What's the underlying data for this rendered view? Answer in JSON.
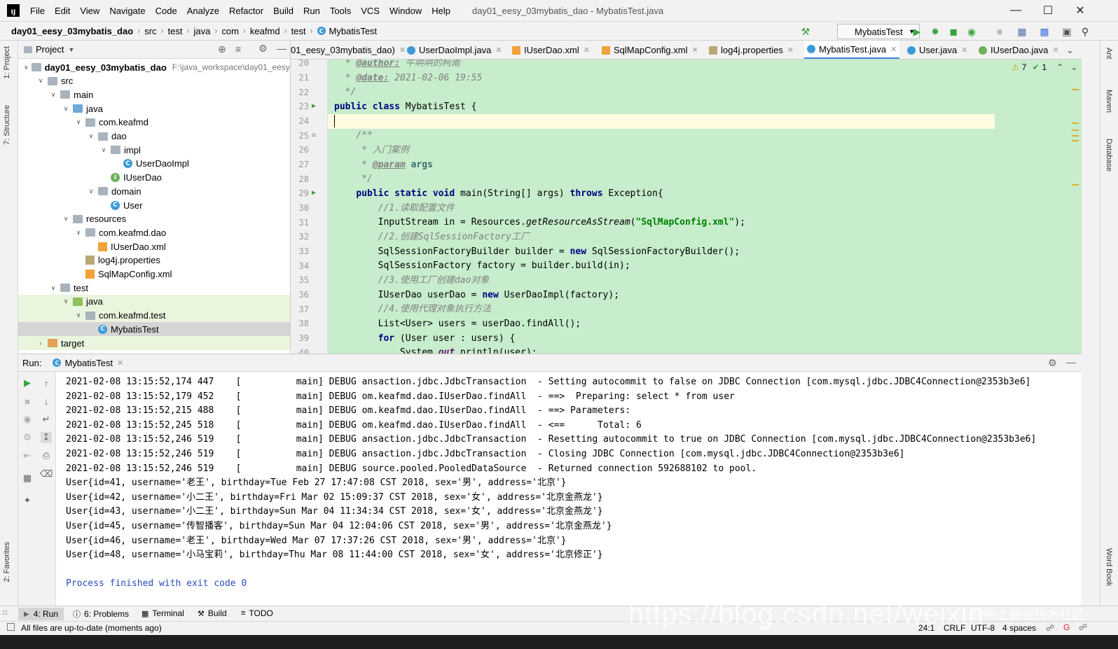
{
  "menu": {
    "items": [
      "File",
      "Edit",
      "View",
      "Navigate",
      "Code",
      "Analyze",
      "Refactor",
      "Build",
      "Run",
      "Tools",
      "VCS",
      "Window",
      "Help"
    ],
    "window_title": "day01_eesy_03mybatis_dao - MybatisTest.java"
  },
  "breadcrumb": [
    "day01_eesy_03mybatis_dao",
    "src",
    "test",
    "java",
    "com",
    "keafmd",
    "test",
    "MybatisTest"
  ],
  "run_config": "MybatisTest",
  "left_tools": {
    "project": "1: Project",
    "structure": "7: Structure",
    "favorites": "2: Favorites"
  },
  "right_tools": {
    "ant": "Ant",
    "maven": "Maven",
    "database": "Database",
    "wordbook": "Word Book"
  },
  "project_panel": {
    "title": "Project",
    "tree": [
      {
        "label": "day01_eesy_03mybatis_dao",
        "extra": "F:\\java_workspace\\day01_eesy_",
        "depth": 0,
        "icon": "folder",
        "open": true,
        "bold": true
      },
      {
        "label": "src",
        "depth": 1,
        "icon": "folder",
        "open": true
      },
      {
        "label": "main",
        "depth": 2,
        "icon": "folder",
        "open": true
      },
      {
        "label": "java",
        "depth": 3,
        "icon": "folder-blue",
        "open": true
      },
      {
        "label": "com.keafmd",
        "depth": 4,
        "icon": "package",
        "open": true
      },
      {
        "label": "dao",
        "depth": 5,
        "icon": "package",
        "open": true
      },
      {
        "label": "impl",
        "depth": 6,
        "icon": "package",
        "open": true
      },
      {
        "label": "UserDaoImpl",
        "depth": 7,
        "icon": "class"
      },
      {
        "label": "IUserDao",
        "depth": 6,
        "icon": "interface"
      },
      {
        "label": "domain",
        "depth": 5,
        "icon": "package",
        "open": true
      },
      {
        "label": "User",
        "depth": 6,
        "icon": "class"
      },
      {
        "label": "resources",
        "depth": 3,
        "icon": "folder",
        "open": true
      },
      {
        "label": "com.keafmd.dao",
        "depth": 4,
        "icon": "package",
        "open": true
      },
      {
        "label": "IUserDao.xml",
        "depth": 5,
        "icon": "xml"
      },
      {
        "label": "log4j.properties",
        "depth": 4,
        "icon": "properties"
      },
      {
        "label": "SqlMapConfig.xml",
        "depth": 4,
        "icon": "xml"
      },
      {
        "label": "test",
        "depth": 2,
        "icon": "folder",
        "open": true
      },
      {
        "label": "java",
        "depth": 3,
        "icon": "folder-green",
        "open": true,
        "highlight": true
      },
      {
        "label": "com.keafmd.test",
        "depth": 4,
        "icon": "package",
        "open": true,
        "highlight": true
      },
      {
        "label": "MybatisTest",
        "depth": 5,
        "icon": "class",
        "selected": true
      },
      {
        "label": "target",
        "depth": 1,
        "icon": "folder-orange",
        "open": false,
        "highlight": true
      }
    ]
  },
  "editor": {
    "tabs": [
      {
        "label": "01_eesy_03mybatis_dao)",
        "icon": "none"
      },
      {
        "label": "UserDaoImpl.java",
        "icon": "class"
      },
      {
        "label": "IUserDao.xml",
        "icon": "xml"
      },
      {
        "label": "SqlMapConfig.xml",
        "icon": "xml"
      },
      {
        "label": "log4j.properties",
        "icon": "properties"
      },
      {
        "label": "MybatisTest.java",
        "icon": "class",
        "active": true
      },
      {
        "label": "User.java",
        "icon": "class"
      },
      {
        "label": "IUserDao.java",
        "icon": "interface"
      }
    ],
    "inspections": {
      "warnings": "7",
      "ok": "1"
    },
    "line_numbers": [
      "20",
      "21",
      "22",
      "23",
      "24",
      "25",
      "26",
      "27",
      "28",
      "29",
      "30",
      "31",
      "32",
      "33",
      "34",
      "35",
      "36",
      "37",
      "38",
      "39",
      "40"
    ],
    "lines": {
      "l20_tag": "@author:",
      "l20_text": " 牛哄哄的柯南",
      "l21_tag": "@date:",
      "l21_text": " 2021-02-06 19:55",
      "l22": "*/",
      "l23_kw": "public class",
      "l23_rest": " MybatisTest {",
      "l25": "/**",
      "l26": "* 入门案例",
      "l27_tag": "@param",
      "l27_param": "args",
      "l28": "*/",
      "l29_kw1": "public static void",
      "l29_mid": " main(String[] args) ",
      "l29_kw2": "throws",
      "l29_end": " Exception{",
      "l30": "//1.读取配置文件",
      "l31_a": "InputStream in = Resources.",
      "l31_method": "getResourceAsStream",
      "l31_b": "(",
      "l31_str": "\"SqlMapConfig.xml\"",
      "l31_c": ");",
      "l32": "//2.创建SqlSessionFactory工厂",
      "l33_a": "SqlSessionFactoryBuilder builder = ",
      "l33_kw": "new",
      "l33_b": " SqlSessionFactoryBuilder();",
      "l34": "SqlSessionFactory factory = builder.build(in);",
      "l35": "//3.使用工厂创建dao对象",
      "l36_a": "IUserDao userDao = ",
      "l36_kw": "new",
      "l36_b": " UserDaoImpl(factory);",
      "l37": "//4.使用代理对象执行方法",
      "l38": "List<User> users = userDao.findAll();",
      "l39_kw": "for",
      "l39_b": " (User user : users) {",
      "l40_a": "System.",
      "l40_field": "out",
      "l40_b": ".println(user);"
    }
  },
  "run_panel": {
    "label": "Run:",
    "tab": "MybatisTest",
    "console": [
      "2021-02-08 13:15:52,174 447    [          main] DEBUG ansaction.jdbc.JdbcTransaction  - Setting autocommit to false on JDBC Connection [com.mysql.jdbc.JDBC4Connection@2353b3e6]",
      "2021-02-08 13:15:52,179 452    [          main] DEBUG om.keafmd.dao.IUserDao.findAll  - ==>  Preparing: select * from user",
      "2021-02-08 13:15:52,215 488    [          main] DEBUG om.keafmd.dao.IUserDao.findAll  - ==> Parameters:",
      "2021-02-08 13:15:52,245 518    [          main] DEBUG om.keafmd.dao.IUserDao.findAll  - <==      Total: 6",
      "2021-02-08 13:15:52,246 519    [          main] DEBUG ansaction.jdbc.JdbcTransaction  - Resetting autocommit to true on JDBC Connection [com.mysql.jdbc.JDBC4Connection@2353b3e6]",
      "2021-02-08 13:15:52,246 519    [          main] DEBUG ansaction.jdbc.JdbcTransaction  - Closing JDBC Connection [com.mysql.jdbc.JDBC4Connection@2353b3e6]",
      "2021-02-08 13:15:52,246 519    [          main] DEBUG source.pooled.PooledDataSource  - Returned connection 592688102 to pool.",
      "User{id=41, username='老王', birthday=Tue Feb 27 17:47:08 CST 2018, sex='男', address='北京'}",
      "User{id=42, username='小二王', birthday=Fri Mar 02 15:09:37 CST 2018, sex='女', address='北京金燕龙'}",
      "User{id=43, username='小二王', birthday=Sun Mar 04 11:34:34 CST 2018, sex='女', address='北京金燕龙'}",
      "User{id=45, username='传智播客', birthday=Sun Mar 04 12:04:06 CST 2018, sex='男', address='北京金燕龙'}",
      "User{id=46, username='老王', birthday=Wed Mar 07 17:37:26 CST 2018, sex='男', address='北京'}",
      "User{id=48, username='小马宝莉', birthday=Thu Mar 08 11:44:00 CST 2018, sex='女', address='北京修正'}",
      "",
      "Process finished with exit code 0"
    ]
  },
  "bottom_tabs": [
    "4: Run",
    "6: Problems",
    "Terminal",
    "Build",
    "TODO"
  ],
  "status": {
    "message": "All files are up-to-date (moments ago)",
    "position": "24:1",
    "line_sep": "CRLF",
    "encoding": "UTF-8",
    "indent": "4 spaces"
  },
  "watermark": "https://blog.csdn.net/weixin",
  "watermark2": "@稀土掘金技术社区",
  "colors": {
    "editor_bg": "#c7edcc",
    "current_line": "#fffbe1",
    "accent": "#3d8ad8"
  }
}
